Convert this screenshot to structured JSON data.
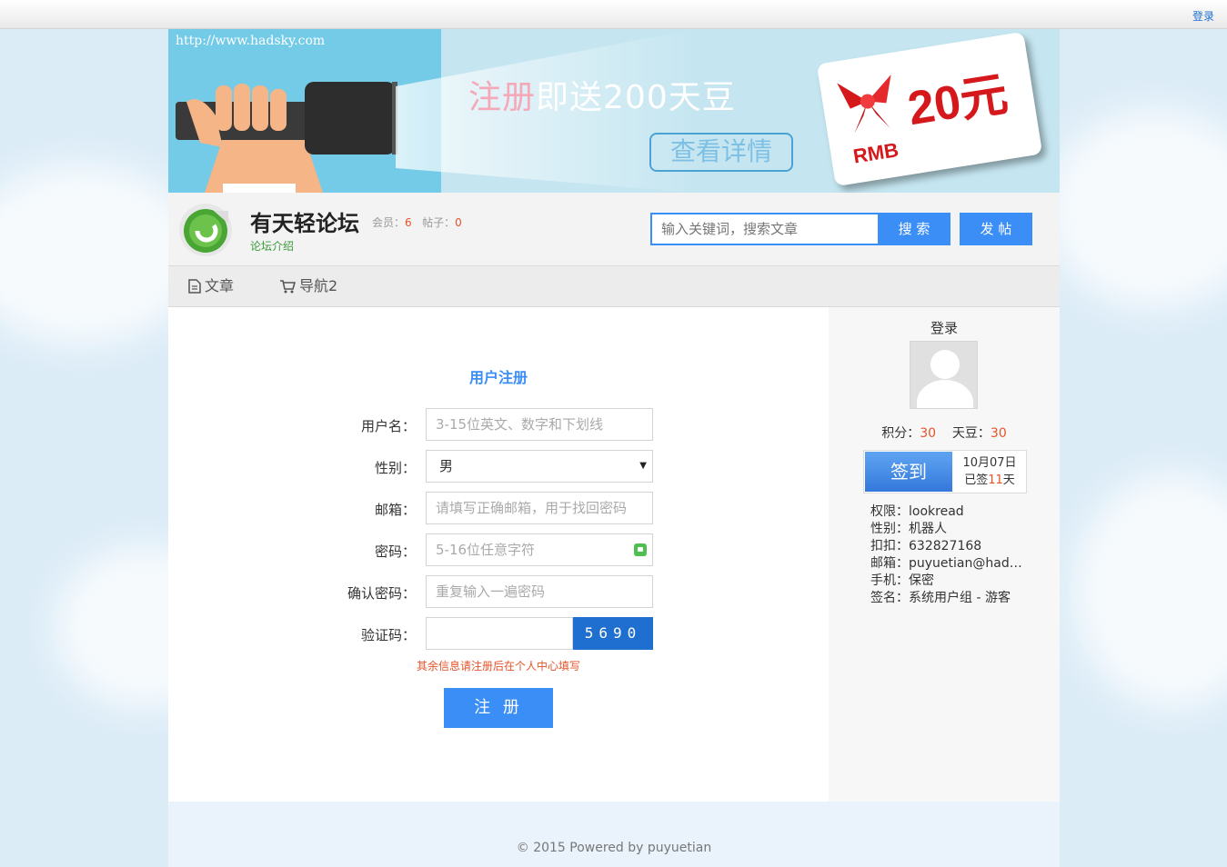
{
  "topbar": {
    "login": "登录"
  },
  "banner": {
    "url": "http://www.hadsky.com",
    "promo_a": "注册",
    "promo_b": "即送200天豆",
    "detail_button": "查看详情",
    "card_amount": "20元",
    "card_currency": "RMB"
  },
  "header": {
    "site_title": "有天轻论坛",
    "members_label": "会员：",
    "members_count": "6",
    "posts_label": "帖子：",
    "posts_count": "0",
    "intro_link": "论坛介绍",
    "search_placeholder": "输入关键词，搜索文章",
    "search_button": "搜 索",
    "post_button": "发 帖"
  },
  "nav": {
    "items": [
      {
        "label": "文章",
        "icon": "document-icon"
      },
      {
        "label": "导航2",
        "icon": "cart-icon"
      }
    ]
  },
  "form": {
    "title": "用户注册",
    "username_label": "用户名：",
    "username_placeholder": "3-15位英文、数字和下划线",
    "gender_label": "性别：",
    "gender_value": "男",
    "email_label": "邮箱：",
    "email_placeholder": "请填写正确邮箱，用于找回密码",
    "password_label": "密码：",
    "password_placeholder": "5-16位任意字符",
    "confirm_label": "确认密码：",
    "confirm_placeholder": "重复输入一遍密码",
    "captcha_label": "验证码：",
    "captcha_code": "5690",
    "hint": "其余信息请注册后在个人中心填写",
    "submit": "注 册"
  },
  "sidebar": {
    "title": "登录",
    "points_label": "积分：",
    "points_value": "30",
    "beans_label": "天豆：",
    "beans_value": "30",
    "checkin_button": "签到",
    "checkin_date": "10月07日",
    "checkin_prefix": "已签",
    "checkin_days": "11",
    "checkin_suffix": "天",
    "info": [
      "权限：lookread",
      "性别：机器人",
      "扣扣：632827168",
      "邮箱：puyuetian@hadsky.com",
      "手机：保密",
      "签名：系统用户组 - 游客"
    ]
  },
  "footer": {
    "copyright": "© 2015 Powered by puyuetian"
  },
  "colors": {
    "accent": "#3a8ef6",
    "highlight": "#e5532a"
  }
}
